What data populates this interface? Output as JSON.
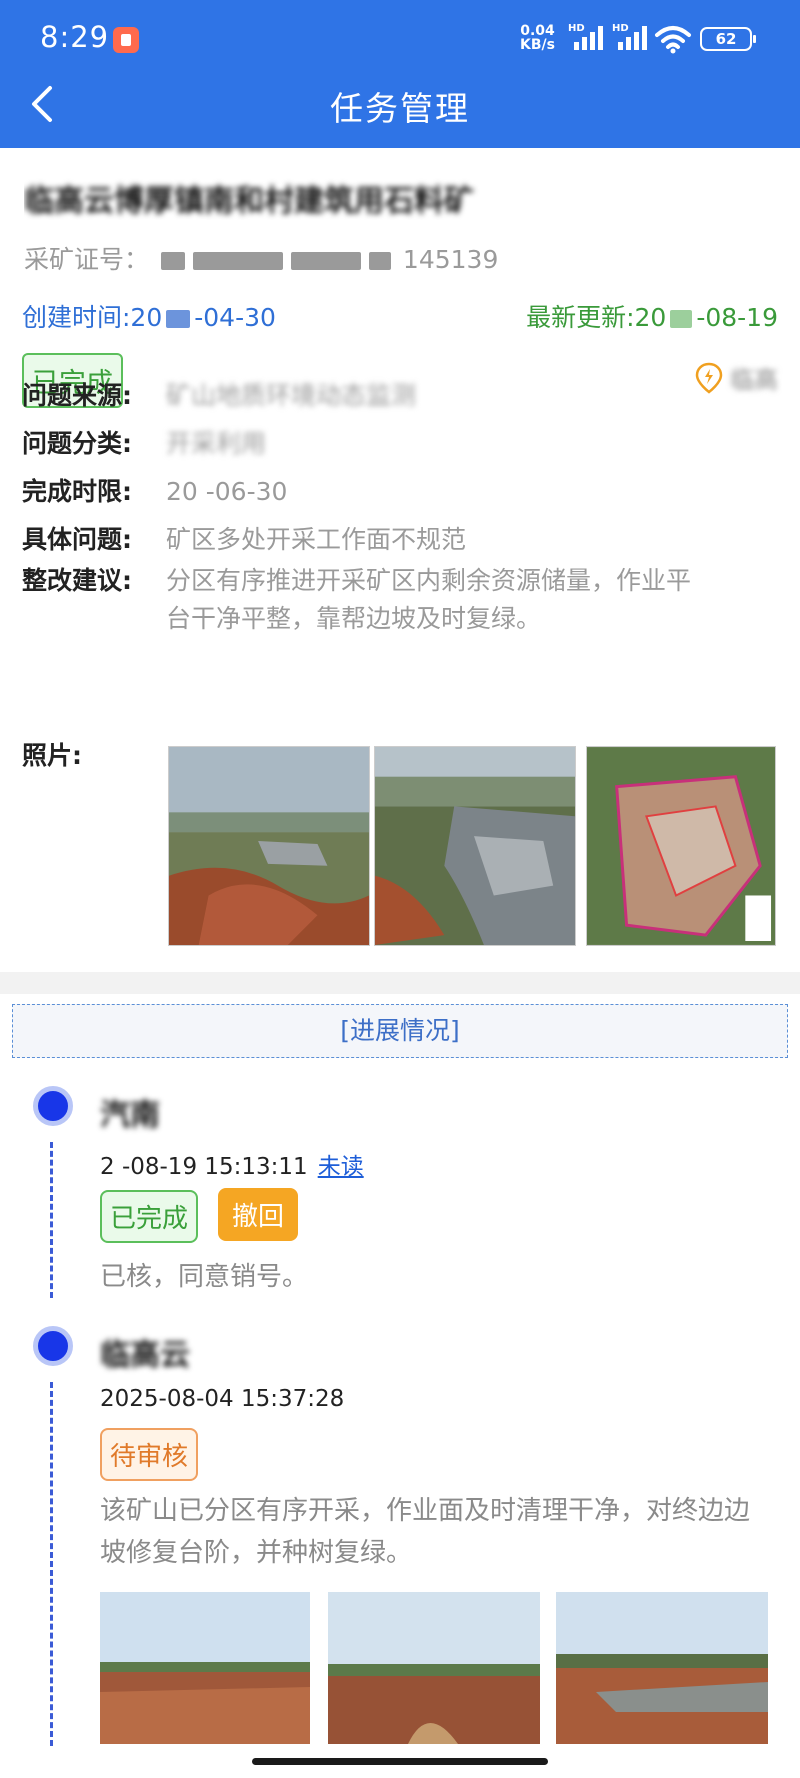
{
  "status_bar": {
    "time": "8:29",
    "net_speed": "0.04",
    "net_unit": "KB/s",
    "hd1": "HD",
    "hd2": "HD",
    "battery": "62"
  },
  "nav": {
    "title": "任务管理",
    "back_icon": "chevron-left-icon"
  },
  "task": {
    "title": "临高云博厚镇南和村建筑用石料矿",
    "code_label": "采矿证号：",
    "code_tail": "145139",
    "created": "创建时间:20",
    "created_date": "-04-30",
    "updated": "最新更新:20",
    "updated_date": "-08-19",
    "status": "已完成",
    "location_icon": "lightning-location-icon",
    "location": "临高",
    "fields": [
      {
        "key": "问题来源:",
        "value": "矿山地质环境动态监测"
      },
      {
        "key": "问题分类:",
        "value": "开采利用"
      },
      {
        "key": "完成时限:",
        "value": "20  -06-30"
      },
      {
        "key": "具体问题:",
        "value": "矿区多处开采工作面不规范"
      },
      {
        "key": "整改建议:",
        "value": "分区有序推进开采矿区内剩余资源储量，作业平台干净平整，靠帮边坡及时复绿。"
      }
    ],
    "photos_label": "照片:"
  },
  "progress": {
    "header": "[进展情况]",
    "entries": [
      {
        "name": "汽南",
        "time": "2  -08-19 15:13:11",
        "unread": "未读",
        "status": "已完成",
        "action": "撤回",
        "text": "已核，同意销号。"
      },
      {
        "name": "临高云",
        "time": "2025-08-04 15:37:28",
        "status": "待审核",
        "text": "该矿山已分区有序开采，作业面及时清理干净，对终边边坡修复台阶，并种树复绿。"
      }
    ]
  },
  "colors": {
    "brand_blue": "#2f74e6",
    "done_green": "#3aa03a",
    "pending_orange": "#e07a2a",
    "revoke_orange": "#f5a623",
    "timeline_dot": "#1836e8"
  }
}
